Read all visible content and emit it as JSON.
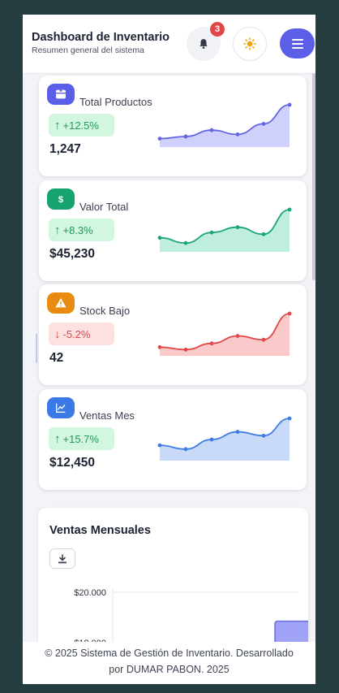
{
  "header": {
    "title": "Dashboard de Inventario",
    "subtitle": "Resumen general del sistema",
    "notifications_count": "3",
    "icons": {
      "notifications": "bell-icon",
      "theme": "sun-icon",
      "menu": "hamburger-menu-icon"
    }
  },
  "cards": [
    {
      "label": "Total Productos",
      "value": "1,247",
      "change": "+12.5%",
      "direction": "up",
      "icon": "box-icon",
      "icon_bg": "#5b5ee6",
      "pill_bg": "#d3f6e1",
      "pill_color": "#1e9b55",
      "line_color": "#6366e0",
      "fill_color": "#cfd0fb",
      "trend": [
        2,
        2.5,
        4,
        3,
        5.5,
        10
      ]
    },
    {
      "label": "Valor Total",
      "value": "$45,230",
      "change": "+8.3%",
      "direction": "up",
      "icon": "dollar-icon",
      "icon_bg": "#16a46e",
      "pill_bg": "#d3f6e1",
      "pill_color": "#1e9b55",
      "line_color": "#1aa774",
      "fill_color": "#c0eedd",
      "trend": [
        4,
        2.5,
        5.5,
        7,
        5,
        12
      ]
    },
    {
      "label": "Stock Bajo",
      "value": "42",
      "change": "-5.2%",
      "direction": "down",
      "icon": "warning-icon",
      "icon_bg": "#e88b10",
      "pill_bg": "#fde0e0",
      "pill_color": "#dc4b4b",
      "line_color": "#e04848",
      "fill_color": "#fac9c9",
      "trend": [
        3.5,
        2.5,
        5,
        8,
        6.5,
        17
      ]
    },
    {
      "label": "Ventas Mes",
      "value": "$12,450",
      "change": "+15.7%",
      "direction": "up",
      "icon": "chart-line-icon",
      "icon_bg": "#3b7ae6",
      "pill_bg": "#d3f6e1",
      "pill_color": "#1e9b55",
      "line_color": "#3d7be6",
      "fill_color": "#c8daf7",
      "trend": [
        4,
        3,
        5.5,
        7.5,
        6.5,
        11
      ]
    }
  ],
  "sales_chart": {
    "title": "Ventas Mensuales",
    "download_icon": "download-icon"
  },
  "chart_data": {
    "type": "bar",
    "title": "Ventas Mensuales",
    "y_ticks": [
      "$20.000",
      "$18.000",
      "$16.000"
    ],
    "ylim_visible": [
      15000,
      20500
    ],
    "visible_bars": [
      {
        "value": 16600
      },
      {
        "value": 18850
      }
    ],
    "bar_color": "#a0a2f5",
    "bar_border": "#6a6ce8"
  },
  "footer": {
    "line1": "© 2025 Sistema de Gestión de Inventario. Desarrollado",
    "line2": "por DUMAR PABON. 2025"
  }
}
